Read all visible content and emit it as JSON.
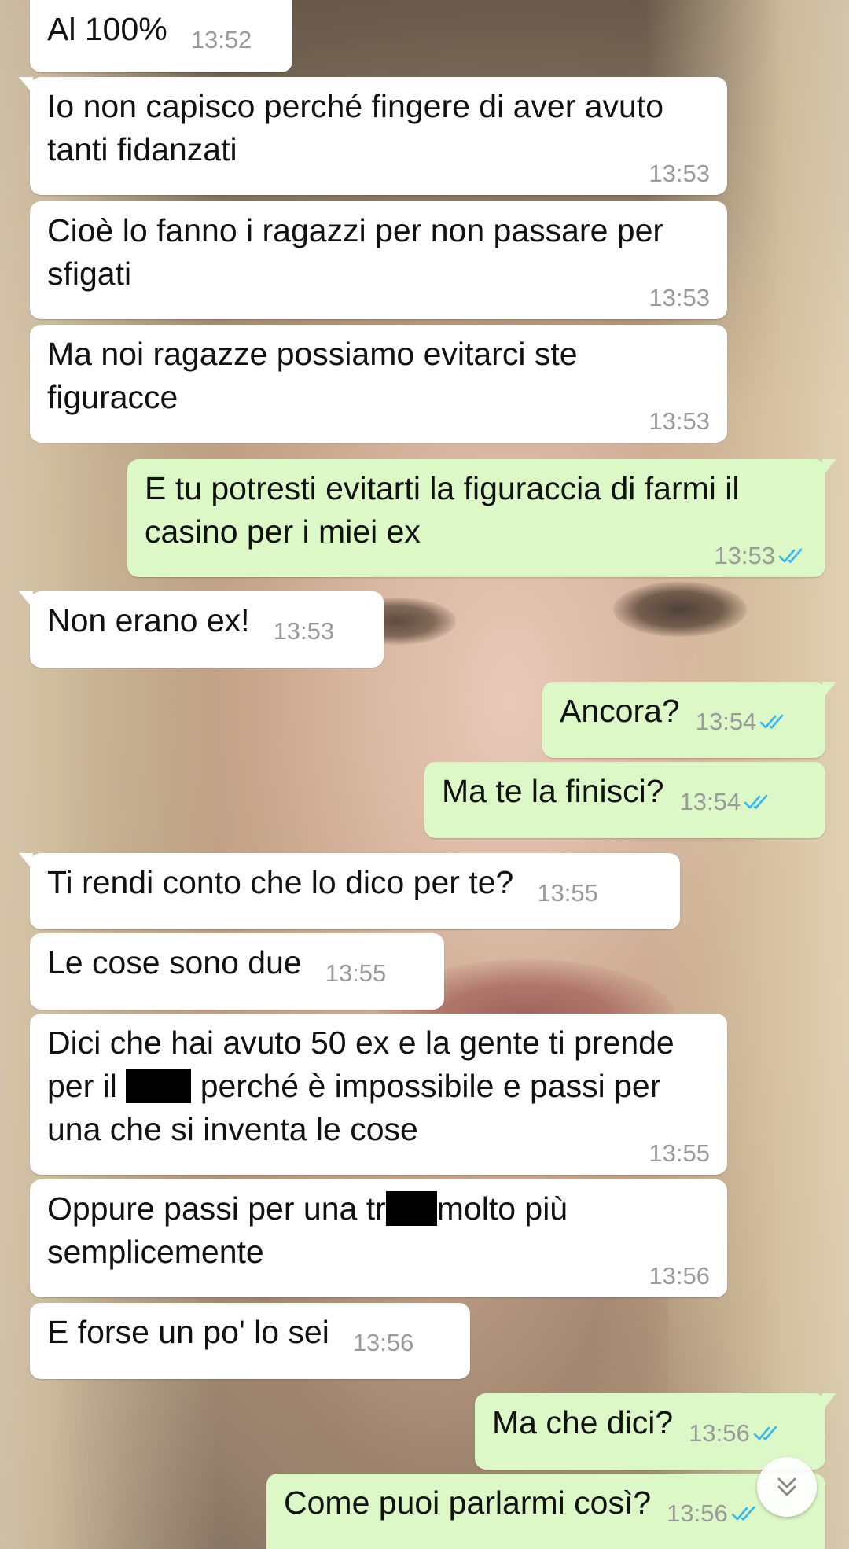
{
  "app": "WhatsApp chat",
  "colors": {
    "incoming_bubble": "#ffffff",
    "outgoing_bubble": "#dcf8c6",
    "timestamp": "#9a9a9a",
    "read_receipt": "#34b7f1"
  },
  "messages": [
    {
      "id": "m1",
      "direction": "incoming",
      "text": "Al 100%",
      "time": "13:52"
    },
    {
      "id": "m2",
      "direction": "incoming",
      "text": "Io non capisco perché fingere di aver avuto tanti fidanzati",
      "time": "13:53"
    },
    {
      "id": "m3",
      "direction": "incoming",
      "text": "Cioè lo fanno i ragazzi per non passare per sfigati",
      "time": "13:53"
    },
    {
      "id": "m4",
      "direction": "incoming",
      "text": "Ma noi ragazze possiamo evitarci ste figuracce",
      "time": "13:53"
    },
    {
      "id": "m5",
      "direction": "outgoing",
      "text": "E tu potresti evitarti la figuraccia di farmi il casino per i miei ex",
      "time": "13:53",
      "status": "read"
    },
    {
      "id": "m6",
      "direction": "incoming",
      "text": "Non erano ex!",
      "time": "13:53"
    },
    {
      "id": "m7",
      "direction": "outgoing",
      "text": "Ancora?",
      "time": "13:54",
      "status": "read"
    },
    {
      "id": "m8",
      "direction": "outgoing",
      "text": "Ma te la finisci?",
      "time": "13:54",
      "status": "read"
    },
    {
      "id": "m9",
      "direction": "incoming",
      "text": "Ti rendi conto che lo dico per te?",
      "time": "13:55"
    },
    {
      "id": "m10",
      "direction": "incoming",
      "text": "Le cose sono due",
      "time": "13:55"
    },
    {
      "id": "m11",
      "direction": "incoming",
      "text_before": "Dici che hai avuto 50 ex e la gente ti prende per il",
      "text_after": "perché è impossibile e passi per una che si inventa le cose",
      "redacted": true,
      "time": "13:55"
    },
    {
      "id": "m12",
      "direction": "incoming",
      "text_before": "Oppure passi per una tr",
      "text_after": "molto più semplicemente",
      "redacted": true,
      "time": "13:56"
    },
    {
      "id": "m13",
      "direction": "incoming",
      "text": "E forse un po' lo sei",
      "time": "13:56"
    },
    {
      "id": "m14",
      "direction": "outgoing",
      "text": "Ma che dici?",
      "time": "13:56",
      "status": "read"
    },
    {
      "id": "m15",
      "direction": "outgoing",
      "text": "Come puoi parlarmi così?",
      "time": "13:56",
      "status": "read"
    }
  ],
  "icons": {
    "read_receipt": "double-check-icon",
    "scroll_down": "double-chevron-down-icon"
  }
}
